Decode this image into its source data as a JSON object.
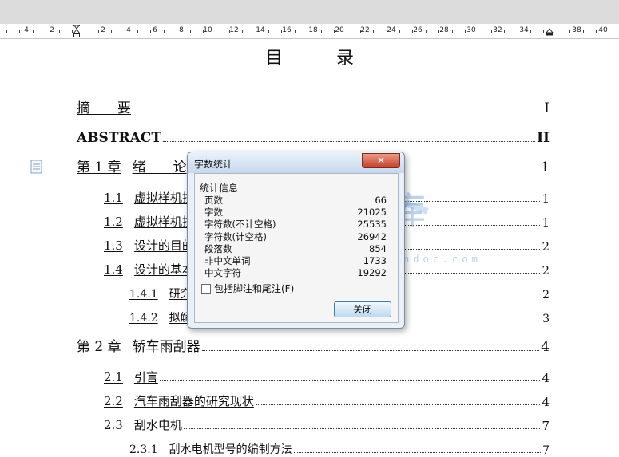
{
  "ruler": {
    "numbers": [
      "4",
      "2",
      "2",
      "4",
      "6",
      "8",
      "10",
      "12",
      "14",
      "16",
      "18",
      "20",
      "22",
      "24",
      "26",
      "28",
      "30",
      "32",
      "34",
      "38",
      "40"
    ]
  },
  "doc": {
    "title": "目  录",
    "entries": [
      {
        "level": 0,
        "num": "",
        "text": "摘　　要",
        "page": "I",
        "bold": false
      },
      {
        "level": 0,
        "num": "",
        "text": "ABSTRACT",
        "page": "II",
        "bold": true
      },
      {
        "level": 0,
        "num": "第 1 章",
        "text": "绪　　论",
        "page": "1",
        "bold": false
      },
      {
        "level": 1,
        "num": "1.1",
        "text": "虚拟样机技",
        "page": "1",
        "bold": false
      },
      {
        "level": 1,
        "num": "1.2",
        "text": "虚拟样机技",
        "page": "1",
        "bold": false
      },
      {
        "level": 1,
        "num": "1.3",
        "text": "设计的目的",
        "page": "2",
        "bold": false
      },
      {
        "level": 1,
        "num": "1.4",
        "text": "设计的基本",
        "page": "2",
        "bold": false
      },
      {
        "level": 2,
        "num": "1.4.1",
        "text": "研究",
        "page": "2",
        "bold": false
      },
      {
        "level": 2,
        "num": "1.4.2",
        "text": "拟解",
        "page": "3",
        "bold": false
      },
      {
        "level": 0,
        "num": "第 2 章",
        "text": "轿车雨刮器",
        "page": "4",
        "bold": false
      },
      {
        "level": 1,
        "num": "2.1",
        "text": "引言",
        "page": "4",
        "bold": false
      },
      {
        "level": 1,
        "num": "2.2",
        "text": "汽车雨刮器的研究现状",
        "page": "4",
        "bold": false
      },
      {
        "level": 1,
        "num": "2.3",
        "text": "刮水电机",
        "page": "7",
        "bold": false
      },
      {
        "level": 2,
        "num": "2.3.1",
        "text": "刮水电机型号的编制方法",
        "page": "7",
        "bold": false
      }
    ]
  },
  "watermark": {
    "chars": "人文库",
    "url": "www.renrendoc.com"
  },
  "dialog": {
    "title": "字数统计",
    "close_glyph": "✕",
    "group_label": "统计信息",
    "stats": [
      {
        "label": "页数",
        "value": "66"
      },
      {
        "label": "字数",
        "value": "21025"
      },
      {
        "label": "字符数(不计空格)",
        "value": "25535"
      },
      {
        "label": "字符数(计空格)",
        "value": "26942"
      },
      {
        "label": "段落数",
        "value": "854"
      },
      {
        "label": "非中文单词",
        "value": "1733"
      },
      {
        "label": "中文字符",
        "value": "19292"
      }
    ],
    "checkbox_label": "包括脚注和尾注(F)",
    "checkbox_checked": false,
    "close_button_label": "关闭"
  }
}
